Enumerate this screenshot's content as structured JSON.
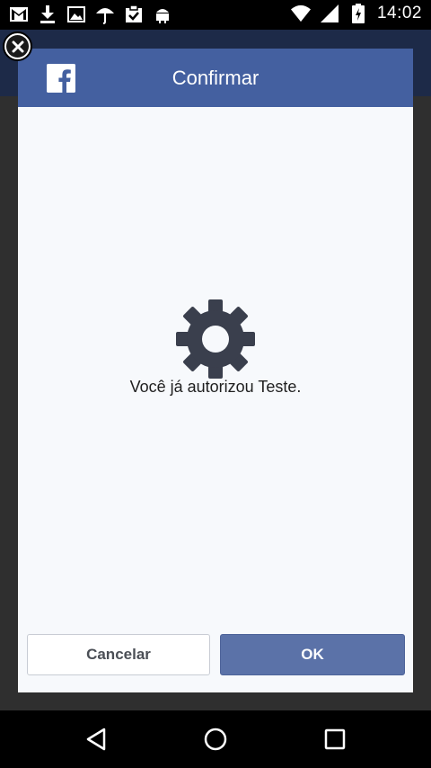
{
  "status_bar": {
    "time": "14:02",
    "icons_left": [
      "gmail-icon",
      "download-icon",
      "image-icon",
      "umbrella-icon",
      "clipboard-check-icon",
      "android-icon"
    ],
    "icons_right": [
      "wifi-icon",
      "signal-icon",
      "battery-icon"
    ]
  },
  "dialog": {
    "title": "Confirmar",
    "message": "Você já autorizou Teste.",
    "cancel_label": "Cancelar",
    "ok_label": "OK"
  },
  "colors": {
    "header": "#4460a0",
    "ok_button": "#5b72a8",
    "gear": "#3a3f4d",
    "dialog_bg": "#f7f9fc"
  },
  "nav_bar": {
    "buttons": [
      "back-icon",
      "home-icon",
      "recents-icon"
    ]
  }
}
